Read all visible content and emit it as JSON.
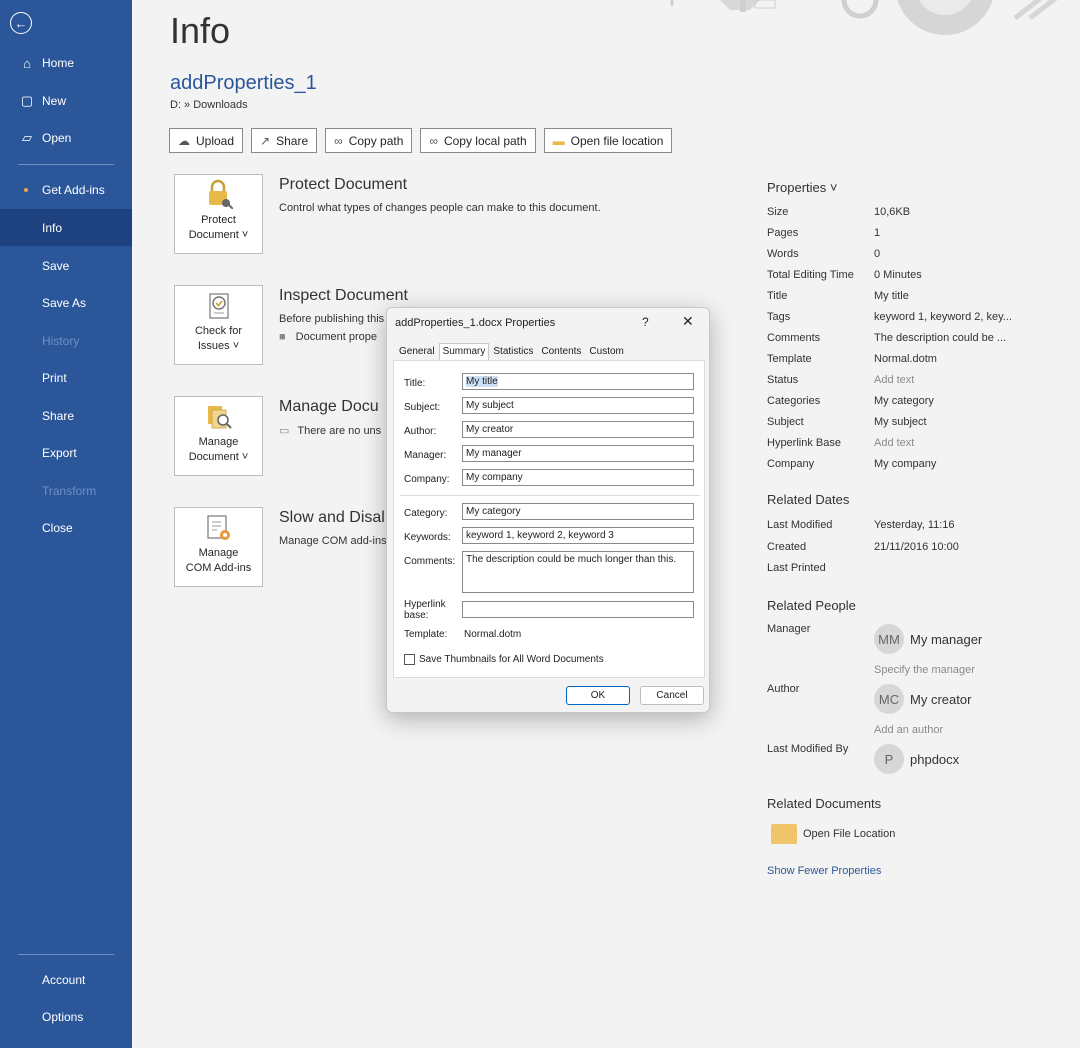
{
  "sidebar": {
    "items": [
      {
        "label": "Home",
        "icon": "home-icon"
      },
      {
        "label": "New",
        "icon": "new-document-icon"
      },
      {
        "label": "Open",
        "icon": "open-folder-icon"
      },
      {
        "label": "Get Add-ins"
      },
      {
        "label": "Info"
      },
      {
        "label": "Save"
      },
      {
        "label": "Save As"
      },
      {
        "label": "History"
      },
      {
        "label": "Print"
      },
      {
        "label": "Share"
      },
      {
        "label": "Export"
      },
      {
        "label": "Transform"
      },
      {
        "label": "Close"
      },
      {
        "label": "Account"
      },
      {
        "label": "Options"
      }
    ],
    "active": "Info",
    "accent": "#2b579a"
  },
  "page": {
    "title": "Info",
    "doc_name": "addProperties_1",
    "doc_path": "D: » Downloads"
  },
  "toolbar": {
    "upload": "Upload",
    "share": "Share",
    "copy_path": "Copy path",
    "copy_local_path": "Copy local path",
    "open_file_location": "Open file location"
  },
  "blocks": {
    "protect": {
      "tile_line1": "Protect",
      "tile_line2": "Document ˅",
      "title": "Protect Document",
      "desc": "Control what types of changes people can make to this document."
    },
    "inspect": {
      "tile_line1": "Check for",
      "tile_line2": "Issues ˅",
      "title": "Inspect Document",
      "desc": "Before publishing this",
      "desc2": "Document prope"
    },
    "manage": {
      "tile_line1": "Manage",
      "tile_line2": "Document ˅",
      "title": "Manage Docu",
      "desc": "There are no uns"
    },
    "slow": {
      "tile_line1": "Manage",
      "tile_line2": "COM Add-ins",
      "title": "Slow and Disal",
      "desc": "Manage COM add-ins"
    }
  },
  "properties": {
    "header": "Properties ˅",
    "rows": [
      {
        "k": "Size",
        "v": "10,6KB"
      },
      {
        "k": "Pages",
        "v": "1"
      },
      {
        "k": "Words",
        "v": "0"
      },
      {
        "k": "Total Editing Time",
        "v": "0 Minutes"
      },
      {
        "k": "Title",
        "v": "My title"
      },
      {
        "k": "Tags",
        "v": "keyword 1, keyword 2, key..."
      },
      {
        "k": "Comments",
        "v": "The description could be ..."
      },
      {
        "k": "Template",
        "v": "Normal.dotm"
      },
      {
        "k": "Status",
        "v": "Add text"
      },
      {
        "k": "Categories",
        "v": "My category"
      },
      {
        "k": "Subject",
        "v": "My subject"
      },
      {
        "k": "Hyperlink Base",
        "v": "Add text"
      },
      {
        "k": "Company",
        "v": "My company"
      }
    ],
    "related_dates": {
      "header": "Related Dates",
      "rows": [
        {
          "k": "Last Modified",
          "v": "Yesterday, 11:16"
        },
        {
          "k": "Created",
          "v": "21/11/2016 10:00"
        },
        {
          "k": "Last Printed",
          "v": ""
        }
      ]
    },
    "related_people": {
      "header": "Related People",
      "manager_label": "Manager",
      "manager_initials": "MM",
      "manager_name": "My manager",
      "manager_hint": "Specify the manager",
      "author_label": "Author",
      "author_initials": "MC",
      "author_name": "My creator",
      "author_hint": "Add an author",
      "lastmod_label": "Last Modified By",
      "lastmod_initials": "P",
      "lastmod_name": "phpdocx"
    },
    "related_documents": {
      "header": "Related Documents",
      "open_location": "Open File Location"
    },
    "show_fewer": "Show Fewer Properties"
  },
  "dialog": {
    "title": "addProperties_1.docx Properties",
    "help": "?",
    "close": "✕",
    "tabs": [
      "General",
      "Summary",
      "Statistics",
      "Contents",
      "Custom"
    ],
    "active_tab": "Summary",
    "fields": {
      "title_label": "Title:",
      "title_value": "My title",
      "subject_label": "Subject:",
      "subject_value": "My subject",
      "author_label": "Author:",
      "author_value": "My creator",
      "manager_label": "Manager:",
      "manager_value": "My manager",
      "company_label": "Company:",
      "company_value": "My company",
      "category_label": "Category:",
      "category_value": "My category",
      "keywords_label": "Keywords:",
      "keywords_value": "keyword 1, keyword 2, keyword 3",
      "comments_label": "Comments:",
      "comments_value": "The description could be much longer than this.",
      "hyperlink_label1": "Hyperlink",
      "hyperlink_label2": "base:",
      "hyperlink_value": "",
      "template_label": "Template:",
      "template_value": "Normal.dotm"
    },
    "thumbnails": "Save Thumbnails for All Word Documents",
    "ok": "OK",
    "cancel": "Cancel"
  }
}
